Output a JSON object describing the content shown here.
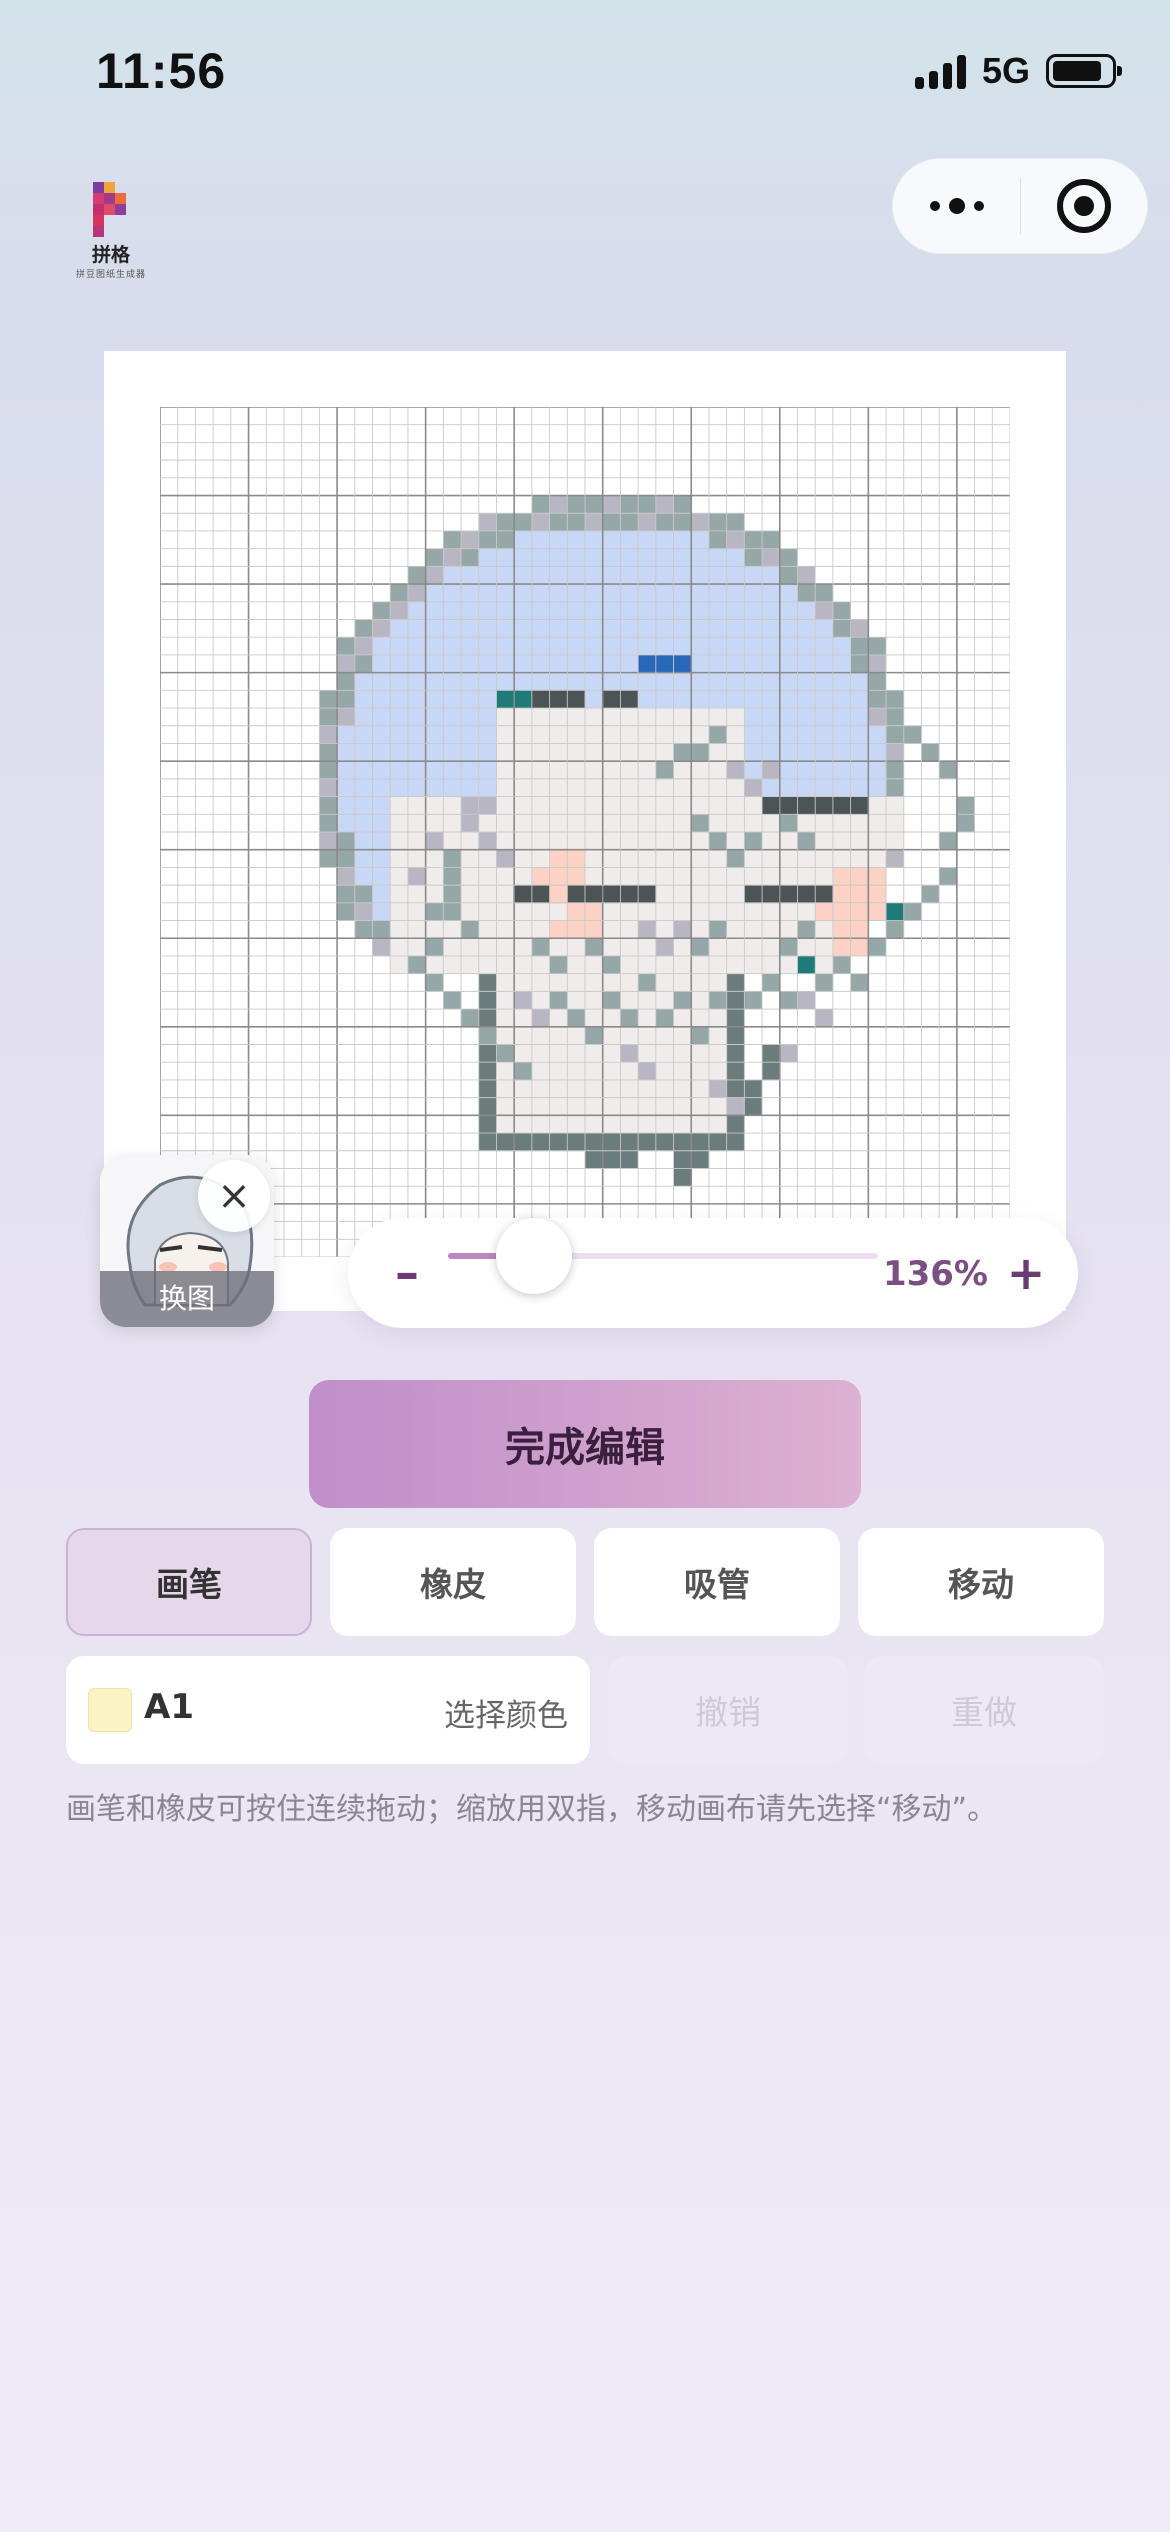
{
  "status_bar": {
    "time": "11:56",
    "network": "5G"
  },
  "app_logo": {
    "name": "拼格",
    "tagline": "拼豆图纸生成器"
  },
  "zoom": {
    "value_text": "136%",
    "minus_label": "–",
    "plus_label": "+",
    "level_fraction": 0.2
  },
  "thumbnail": {
    "change_label": "换图",
    "close_label": "×"
  },
  "actions": {
    "finish_label": "完成编辑"
  },
  "tools": [
    {
      "label": "画笔",
      "active": true
    },
    {
      "label": "橡皮",
      "active": false
    },
    {
      "label": "吸管",
      "active": false
    },
    {
      "label": "移动",
      "active": false
    }
  ],
  "color": {
    "code": "A1",
    "swatch": "#fbf2c6",
    "pick_label": "选择颜色"
  },
  "history": {
    "undo_label": "撤销",
    "redo_label": "重做"
  },
  "hint": "画笔和橡皮可按住连续拖动；缩放用双指，移动画布请先选择“移动”。",
  "colors": {
    "accent": "#6b3c74",
    "hair": "#c9d7f7",
    "skin": "#f0ecec",
    "blush": "#fbd2c4",
    "outline_dark": "#6b7c7c",
    "outline_mid": "#95a7a7",
    "outline_light": "#b9b6c4",
    "teal": "#1f7b78",
    "blue": "#2968b8",
    "grid_line": "#a3a3a3"
  }
}
